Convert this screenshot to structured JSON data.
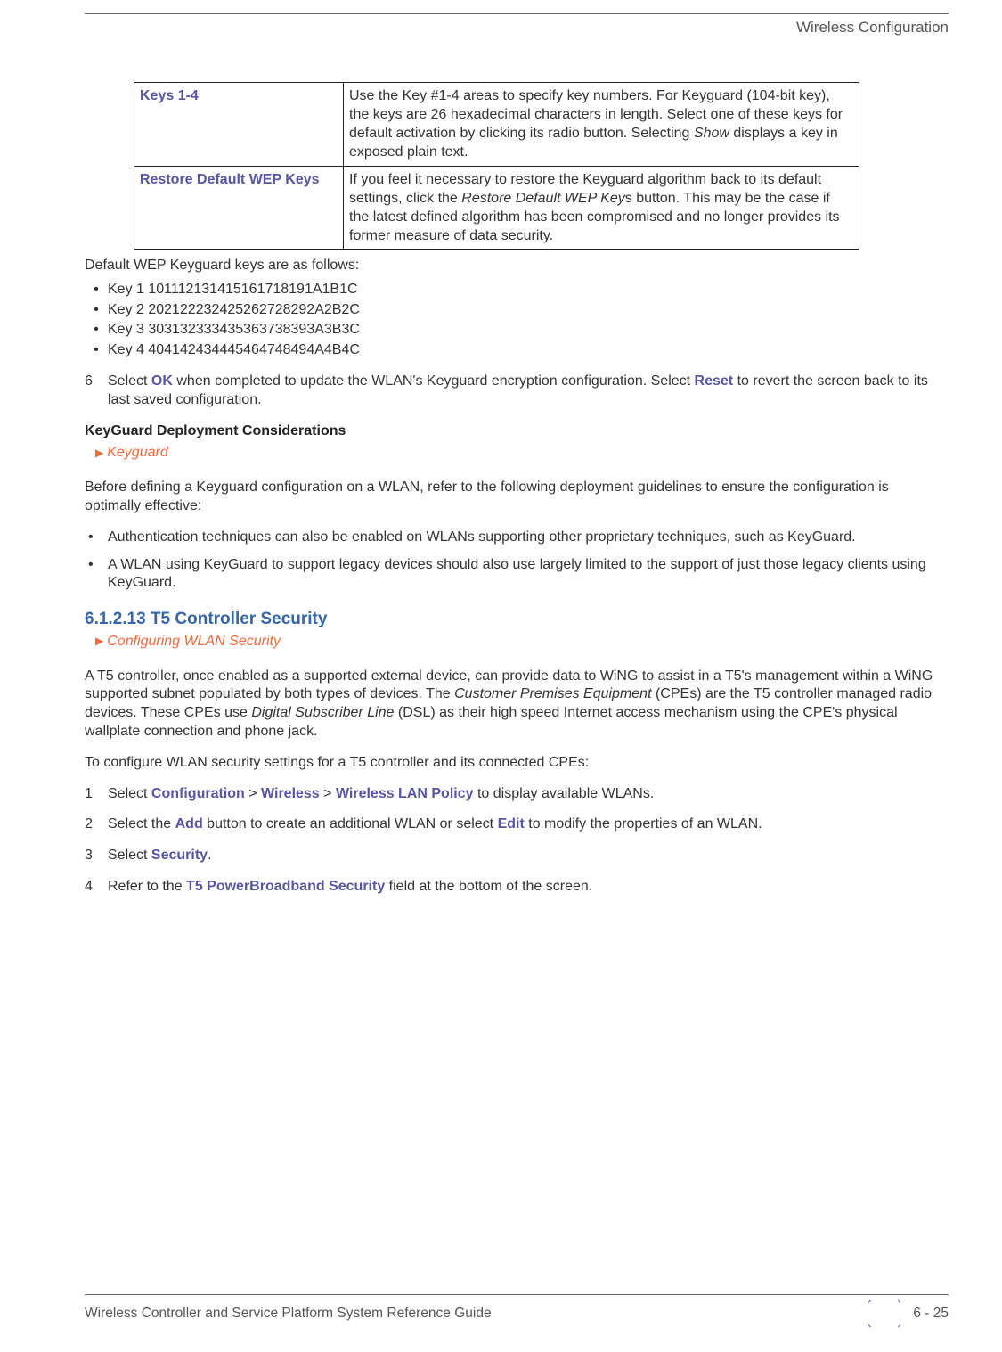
{
  "header": {
    "section": "Wireless Configuration"
  },
  "table": {
    "rows": [
      {
        "label": "Keys 1-4",
        "desc_parts": {
          "a": "Use the Key #1-4 areas to specify key numbers. For Keyguard (104-bit key), the keys are 26 hexadecimal characters in length. Select one of these keys for default activation by clicking its radio button. Selecting ",
          "i": "Show",
          "b": " displays a key in exposed plain text."
        }
      },
      {
        "label": "Restore Default WEP Keys",
        "desc_parts": {
          "a": "If you feel it necessary to restore the Keyguard algorithm back to its default settings, click the ",
          "i": "Restore Default WEP Key",
          "b": "s button. This may be the case if the latest defined algorithm has been compromised and no longer provides its former measure of data security."
        }
      }
    ]
  },
  "defaults_intro": "Default WEP Keyguard keys are as follows:",
  "default_keys": [
    "Key 1 101112131415161718191A1B1C",
    "Key 2 202122232425262728292A2B2C",
    "Key 3 303132333435363738393A3B3C",
    "Key 4 404142434445464748494A4B4C"
  ],
  "step6": {
    "num": "6",
    "a": "Select ",
    "ok": "OK",
    "b": " when completed to update the WLAN's Keyguard encryption configuration. Select ",
    "reset": "Reset",
    "c": " to revert the screen back to its last saved configuration."
  },
  "kg_head": "KeyGuard Deployment Considerations",
  "kg_crumb": "Keyguard",
  "kg_intro": "Before defining a Keyguard configuration on a WLAN, refer to the following deployment guidelines to ensure the configuration is optimally effective:",
  "kg_bullets": [
    "Authentication techniques can also be enabled on WLANs supporting other proprietary techniques, such as KeyGuard.",
    " A WLAN using KeyGuard to support legacy devices should also use largely limited to the support of just those legacy clients using KeyGuard."
  ],
  "t5_head": "6.1.2.13  T5 Controller Security",
  "t5_crumb": "Configuring WLAN Security",
  "t5_p": {
    "a": "A T5 controller, once enabled as a supported external device, can provide data to WiNG to assist in a T5's management within a WiNG supported subnet populated by both types of devices. The ",
    "i1": "Customer Premises Equipment",
    "b": " (CPEs) are the T5 controller managed radio devices. These CPEs use ",
    "i2": "Digital Subscriber Line",
    "c": " (DSL) as their high speed Internet access mechanism using the CPE's physical wallplate connection and phone jack."
  },
  "t5_intro2": "To configure WLAN security settings for a T5 controller and its connected CPEs:",
  "steps": [
    {
      "num": "1",
      "a": "Select ",
      "u1": "Configuration",
      "gt1": " > ",
      "u2": "Wireless",
      "gt2": " > ",
      "u3": "Wireless LAN Policy",
      "b": " to display available WLANs."
    },
    {
      "num": "2",
      "a": "Select the ",
      "u1": "Add",
      "b": " button to create an additional WLAN or select ",
      "u2": "Edit",
      "c": " to modify the properties of an WLAN."
    },
    {
      "num": "3",
      "a": "Select ",
      "u1": "Security",
      "b": "."
    },
    {
      "num": "4",
      "a": "Refer to the ",
      "u1": "T5 PowerBroadband Security",
      "b": " field at the bottom of the screen."
    }
  ],
  "footer": {
    "left": "Wireless Controller and Service Platform System Reference Guide",
    "right": "6 - 25"
  }
}
